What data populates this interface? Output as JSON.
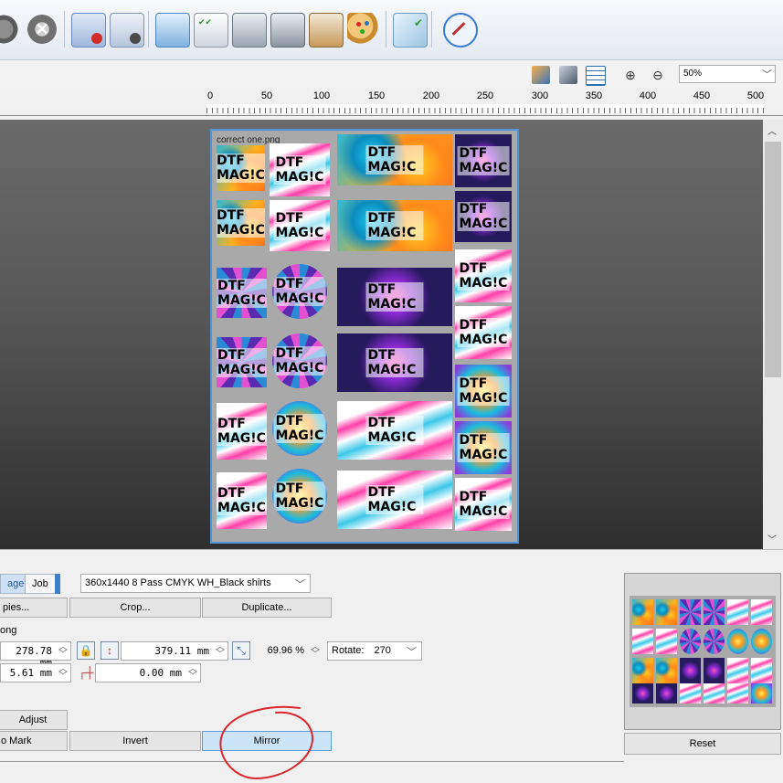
{
  "toolbar": {
    "icons": [
      "gears-icon",
      "cancel-x-icon",
      "stack-stop-icon",
      "stack-play-icon",
      "stack-list-icon",
      "printer-list-icon",
      "printer-icon",
      "printer-queue-icon",
      "printer-inkdrop-icon",
      "paint-palette-icon",
      "color-check-icon",
      "compass-icon"
    ]
  },
  "viewbar": {
    "zoom": "50%",
    "icons": [
      "preview-eye-icon",
      "hide-eye-icon",
      "grid-eye-icon",
      "zoom-in-icon",
      "zoom-out-icon"
    ]
  },
  "ruler": {
    "labels": [
      "0",
      "50",
      "100",
      "150",
      "200",
      "250",
      "300",
      "350",
      "400",
      "450",
      "500"
    ]
  },
  "canvas": {
    "page_filename": "correct one.png",
    "tile_label": "DTF MAG!C"
  },
  "panel": {
    "tabs": {
      "page": "age",
      "job": "Job"
    },
    "profile": "360x1440 8 Pass CMYK WH_Black shirts",
    "buttons": {
      "copies": "pies...",
      "crop": "Crop...",
      "duplicate": "Duplicate..."
    },
    "section_label": "ong",
    "width_value": "278.78 mm",
    "height_value": "379.11 mm",
    "scale_value": "69.96 %",
    "rotate_label": "Rotate:",
    "rotate_value": "270",
    "x_offset_value": "5.61 mm",
    "y_offset_value": "0.00 mm",
    "adjust": "Adjust",
    "mark": "o Mark",
    "invert": "Invert",
    "mirror": "Mirror",
    "reset": "Reset"
  },
  "colors": {
    "accent": "#4f95d8",
    "annotation": "#d9262b",
    "active_button": "#cce4f7"
  }
}
